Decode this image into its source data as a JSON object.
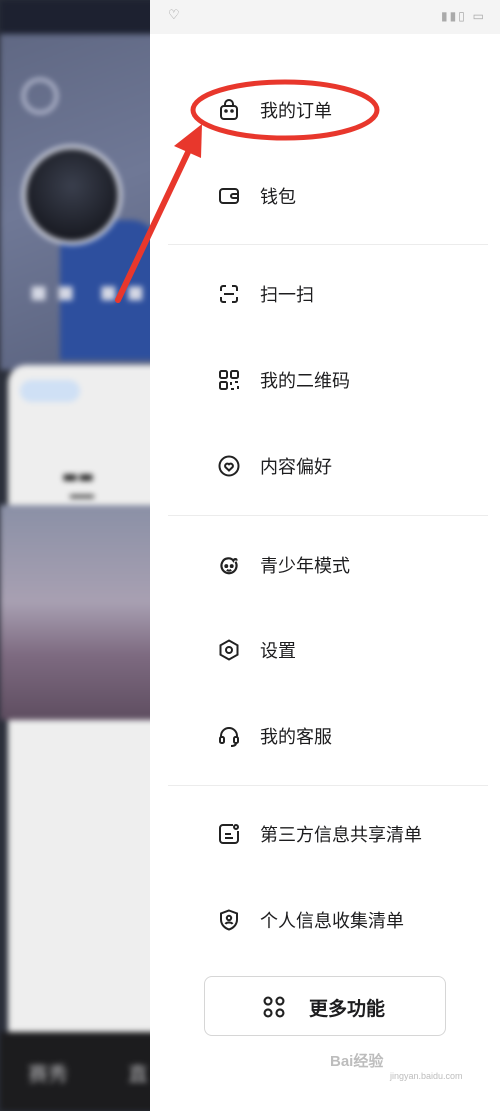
{
  "background": {
    "bottom_tabs": [
      "赛秀",
      "直"
    ]
  },
  "drawer": {
    "items": [
      {
        "label": "我的订单",
        "icon": "shopping-bag-icon"
      },
      {
        "label": "钱包",
        "icon": "wallet-icon"
      },
      {
        "label": "扫一扫",
        "icon": "scan-icon"
      },
      {
        "label": "我的二维码",
        "icon": "qr-code-icon"
      },
      {
        "label": "内容偏好",
        "icon": "heart-icon"
      },
      {
        "label": "青少年模式",
        "icon": "kid-face-icon"
      },
      {
        "label": "设置",
        "icon": "settings-hexagon-icon"
      },
      {
        "label": "我的客服",
        "icon": "headset-icon"
      },
      {
        "label": "第三方信息共享清单",
        "icon": "shared-list-icon"
      },
      {
        "label": "个人信息收集清单",
        "icon": "shield-user-icon"
      }
    ],
    "more_button": {
      "label": "更多功能",
      "icon": "grid-icon"
    }
  },
  "annotation": {
    "color": "#e8372c"
  },
  "watermark": {
    "text": "Bai经验",
    "sub": "jingyan.baidu.com"
  }
}
